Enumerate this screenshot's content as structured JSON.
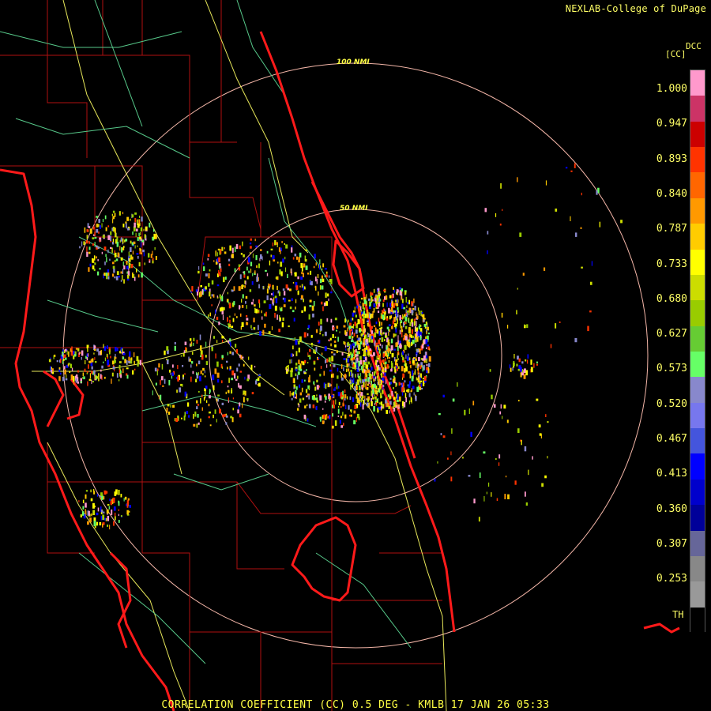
{
  "header": {
    "credit": "NEXLAB-College of DuPage"
  },
  "legend": {
    "product_code": "DCC",
    "unit": "[CC]",
    "ticks": [
      "1.000",
      "0.947",
      "0.893",
      "0.840",
      "0.787",
      "0.733",
      "0.680",
      "0.627",
      "0.573",
      "0.520",
      "0.467",
      "0.413",
      "0.360",
      "0.307",
      "0.253"
    ],
    "missing_label": "TH",
    "colors": [
      "#ff99cc",
      "#cc3366",
      "#cc0000",
      "#ff3300",
      "#ff6600",
      "#ff9900",
      "#ffcc00",
      "#ffff00",
      "#ccdd00",
      "#99cc00",
      "#66cc33",
      "#66ff66",
      "#8888cc",
      "#7777ee",
      "#4455dd",
      "#0000ff",
      "#0000cc",
      "#000099",
      "#666699",
      "#888888",
      "#999999",
      "#000000"
    ]
  },
  "range_rings": {
    "outer_label": "100 NMI",
    "inner_label": "50 NMI"
  },
  "footer": {
    "caption": "CORRELATION COEFFICIENT (CC) 0.5 DEG - KMLB 17 JAN 26 05:33"
  }
}
